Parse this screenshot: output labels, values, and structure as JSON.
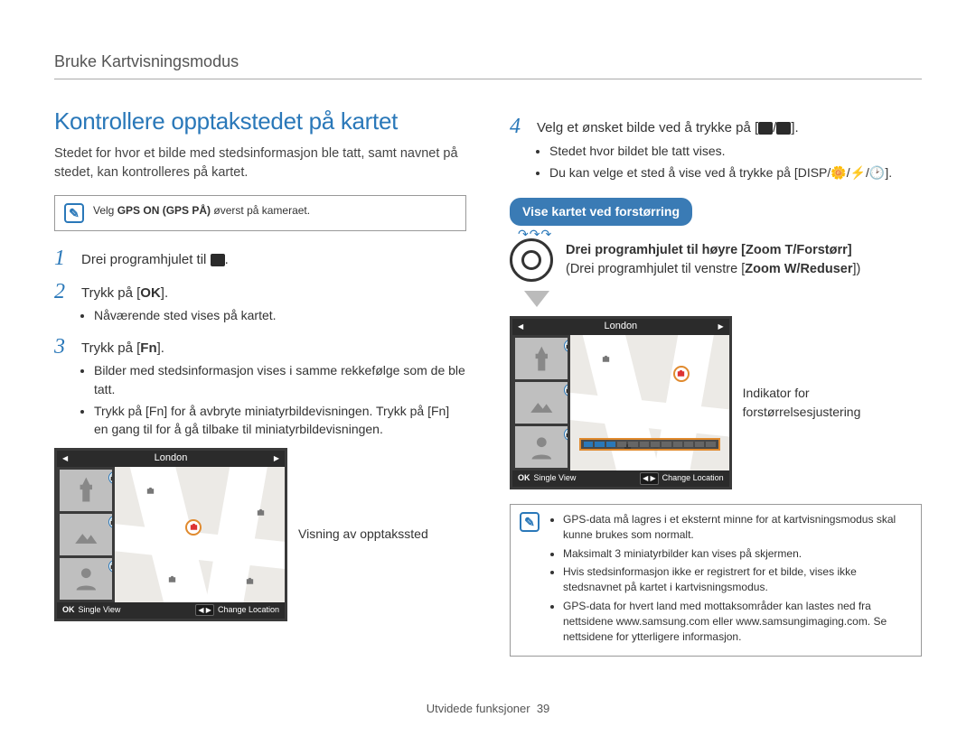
{
  "breadcrumb": "Bruke Kartvisningsmodus",
  "section_title": "Kontrollere opptakstedet på kartet",
  "intro": "Stedet for hvor et bilde med stedsinformasjon ble tatt, samt navnet på stedet, kan kontrolleres på kartet.",
  "note_top": {
    "prefix": "Velg ",
    "bold": "GPS ON (GPS PÅ)",
    "suffix": " øverst på kameraet."
  },
  "steps_left": [
    {
      "num": "1",
      "text": "Drei programhjulet til ",
      "icon": "gps-mode-icon",
      "after": "."
    },
    {
      "num": "2",
      "text": "Trykk på [",
      "btn": "OK",
      "after_btn": "]."
    },
    {
      "num": "3",
      "text": "Trykk på [",
      "btn": "Fn",
      "after_btn": "]."
    }
  ],
  "step2_bullet": "Nåværende sted vises på kartet.",
  "step3_bullets": [
    "Bilder med stedsinformasjon vises i samme rekkefølge som de ble tatt.",
    "Trykk på [Fn] for å avbryte miniatyrbildevisningen. Trykk på [Fn] en gang til for å gå tilbake til miniatyrbildevisningen."
  ],
  "screen1": {
    "location": "London",
    "bottom_left_key": "OK",
    "bottom_left_label": "Single View",
    "bottom_right_label": "Change Location"
  },
  "callout_left": "Visning av opptakssted",
  "step4": {
    "num": "4",
    "text": "Velg et ønsket bilde ved å trykke på [",
    "icons_after": "]."
  },
  "step4_bullets": [
    "Stedet hvor bildet ble tatt vises.",
    "Du kan velge et sted å vise ved å trykke på [DISP/🌼/⚡/🕑]."
  ],
  "pill": "Vise kartet ved forstørring",
  "lens_text": {
    "line1_prefix": "Drei programhjulet til høyre [",
    "line1_bold": "Zoom T/Forstørr",
    "line1_suffix": "]",
    "line2_prefix": "(Drei programhjulet til venstre [",
    "line2_bold": "Zoom W/Reduser",
    "line2_suffix": "])"
  },
  "screen2": {
    "location": "London",
    "bottom_left_key": "OK",
    "bottom_left_label": "Single View",
    "bottom_right_label": "Change Location"
  },
  "callout_right": "Indikator for forstørrelsesjustering",
  "note_bottom": [
    "GPS-data må lagres i et eksternt minne for at kartvisningsmodus skal kunne brukes som normalt.",
    "Maksimalt 3 miniatyrbilder kan vises på skjermen.",
    "Hvis stedsinformasjon ikke er registrert for et bilde, vises ikke stedsnavnet på kartet i kartvisningsmodus.",
    "GPS-data for hvert land med mottaksområder kan lastes ned fra nettsidene www.samsung.com eller www.samsungimaging.com. Se nettsidene for ytterligere informasjon."
  ],
  "footer": {
    "section": "Utvidede funksjoner",
    "page": "39"
  }
}
